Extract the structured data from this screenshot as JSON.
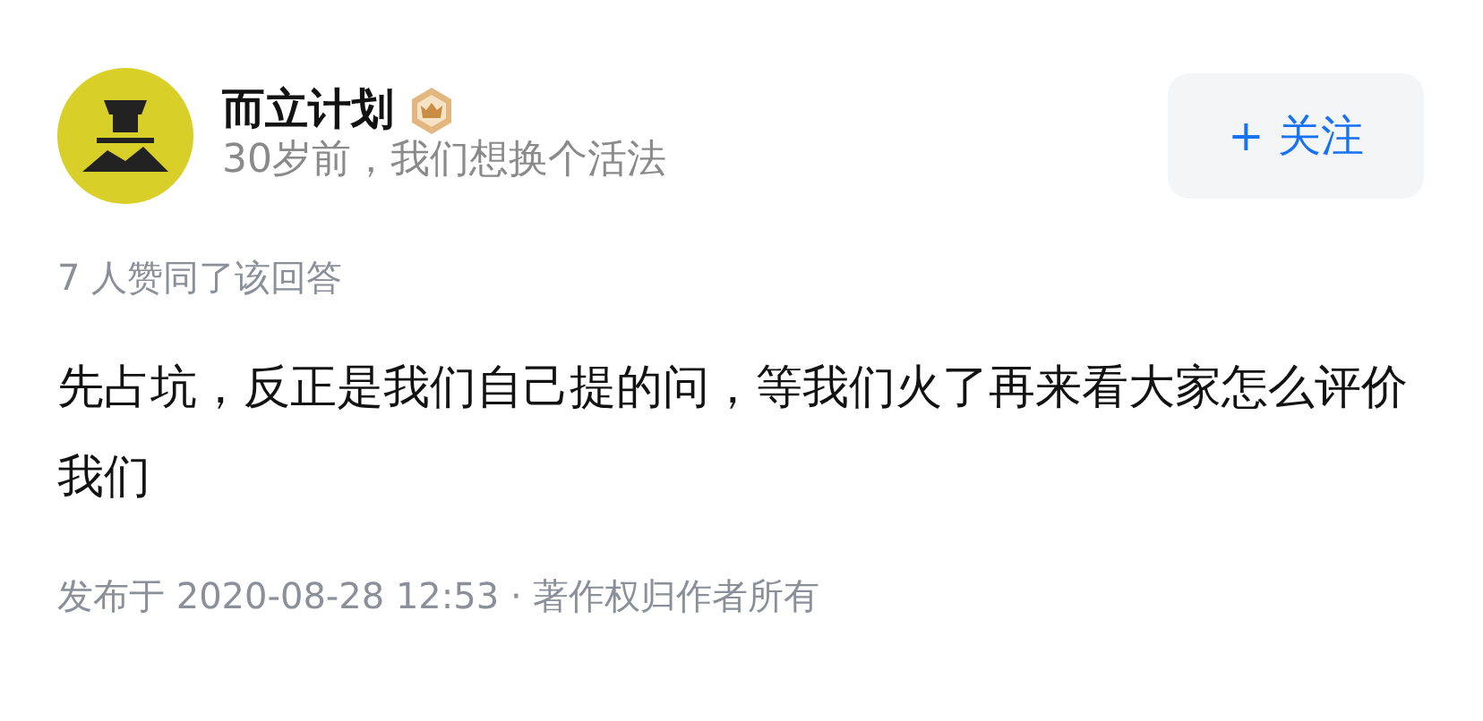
{
  "author": {
    "name": "而立计划",
    "bio": "30岁前，我们想换个活法"
  },
  "follow_button": {
    "label": "+ 关注"
  },
  "upvote_summary": "7 人赞同了该回答",
  "answer": {
    "text": "先占坑，反正是我们自己提的问，等我们火了再来看大家怎么评价我们"
  },
  "footer": "发布于 2020-08-28 12:53 · 著作权归作者所有"
}
